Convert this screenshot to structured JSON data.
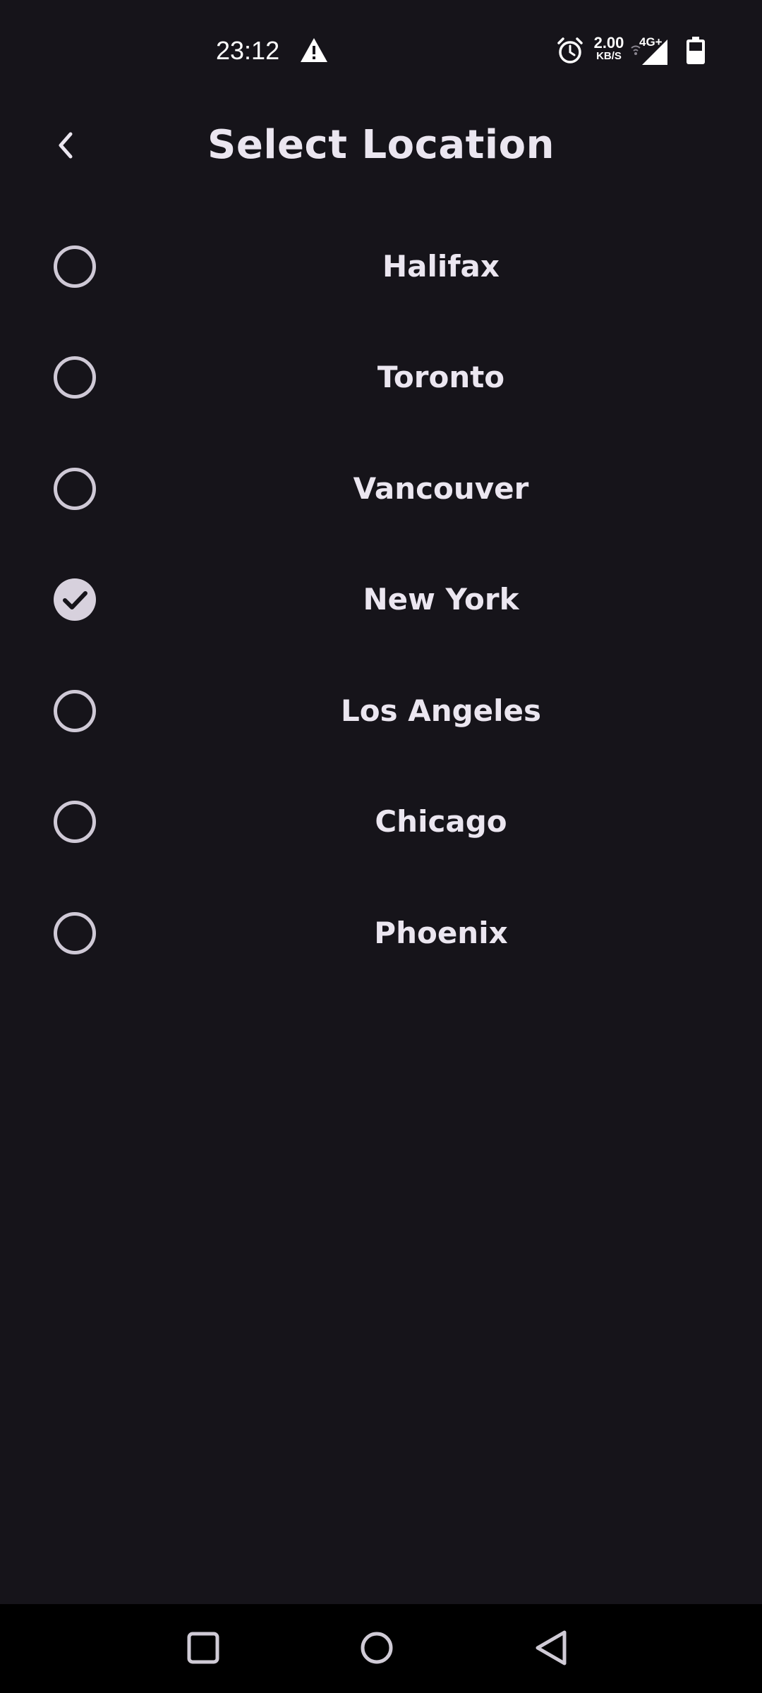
{
  "status_bar": {
    "time": "23:12",
    "speed_value": "2.00",
    "speed_unit": "KB/S",
    "network": "4G+",
    "icons": [
      "warning-icon",
      "alarm-icon",
      "wifi-icon",
      "signal-icon",
      "battery-icon"
    ]
  },
  "header": {
    "title": "Select Location",
    "back_icon": "chevron-left-icon"
  },
  "locations": [
    {
      "label": "Halifax",
      "selected": false
    },
    {
      "label": "Toronto",
      "selected": false
    },
    {
      "label": "Vancouver",
      "selected": false
    },
    {
      "label": "New York",
      "selected": true
    },
    {
      "label": "Los Angeles",
      "selected": false
    },
    {
      "label": "Chicago",
      "selected": false
    },
    {
      "label": "Phoenix",
      "selected": false
    }
  ],
  "nav_bar": {
    "icons": [
      "recent-apps-icon",
      "home-icon",
      "back-icon"
    ]
  },
  "colors": {
    "background": "#16141a",
    "text": "#ebe6f0",
    "radio": "#cfc9d6",
    "nav_bar": "#000000"
  }
}
